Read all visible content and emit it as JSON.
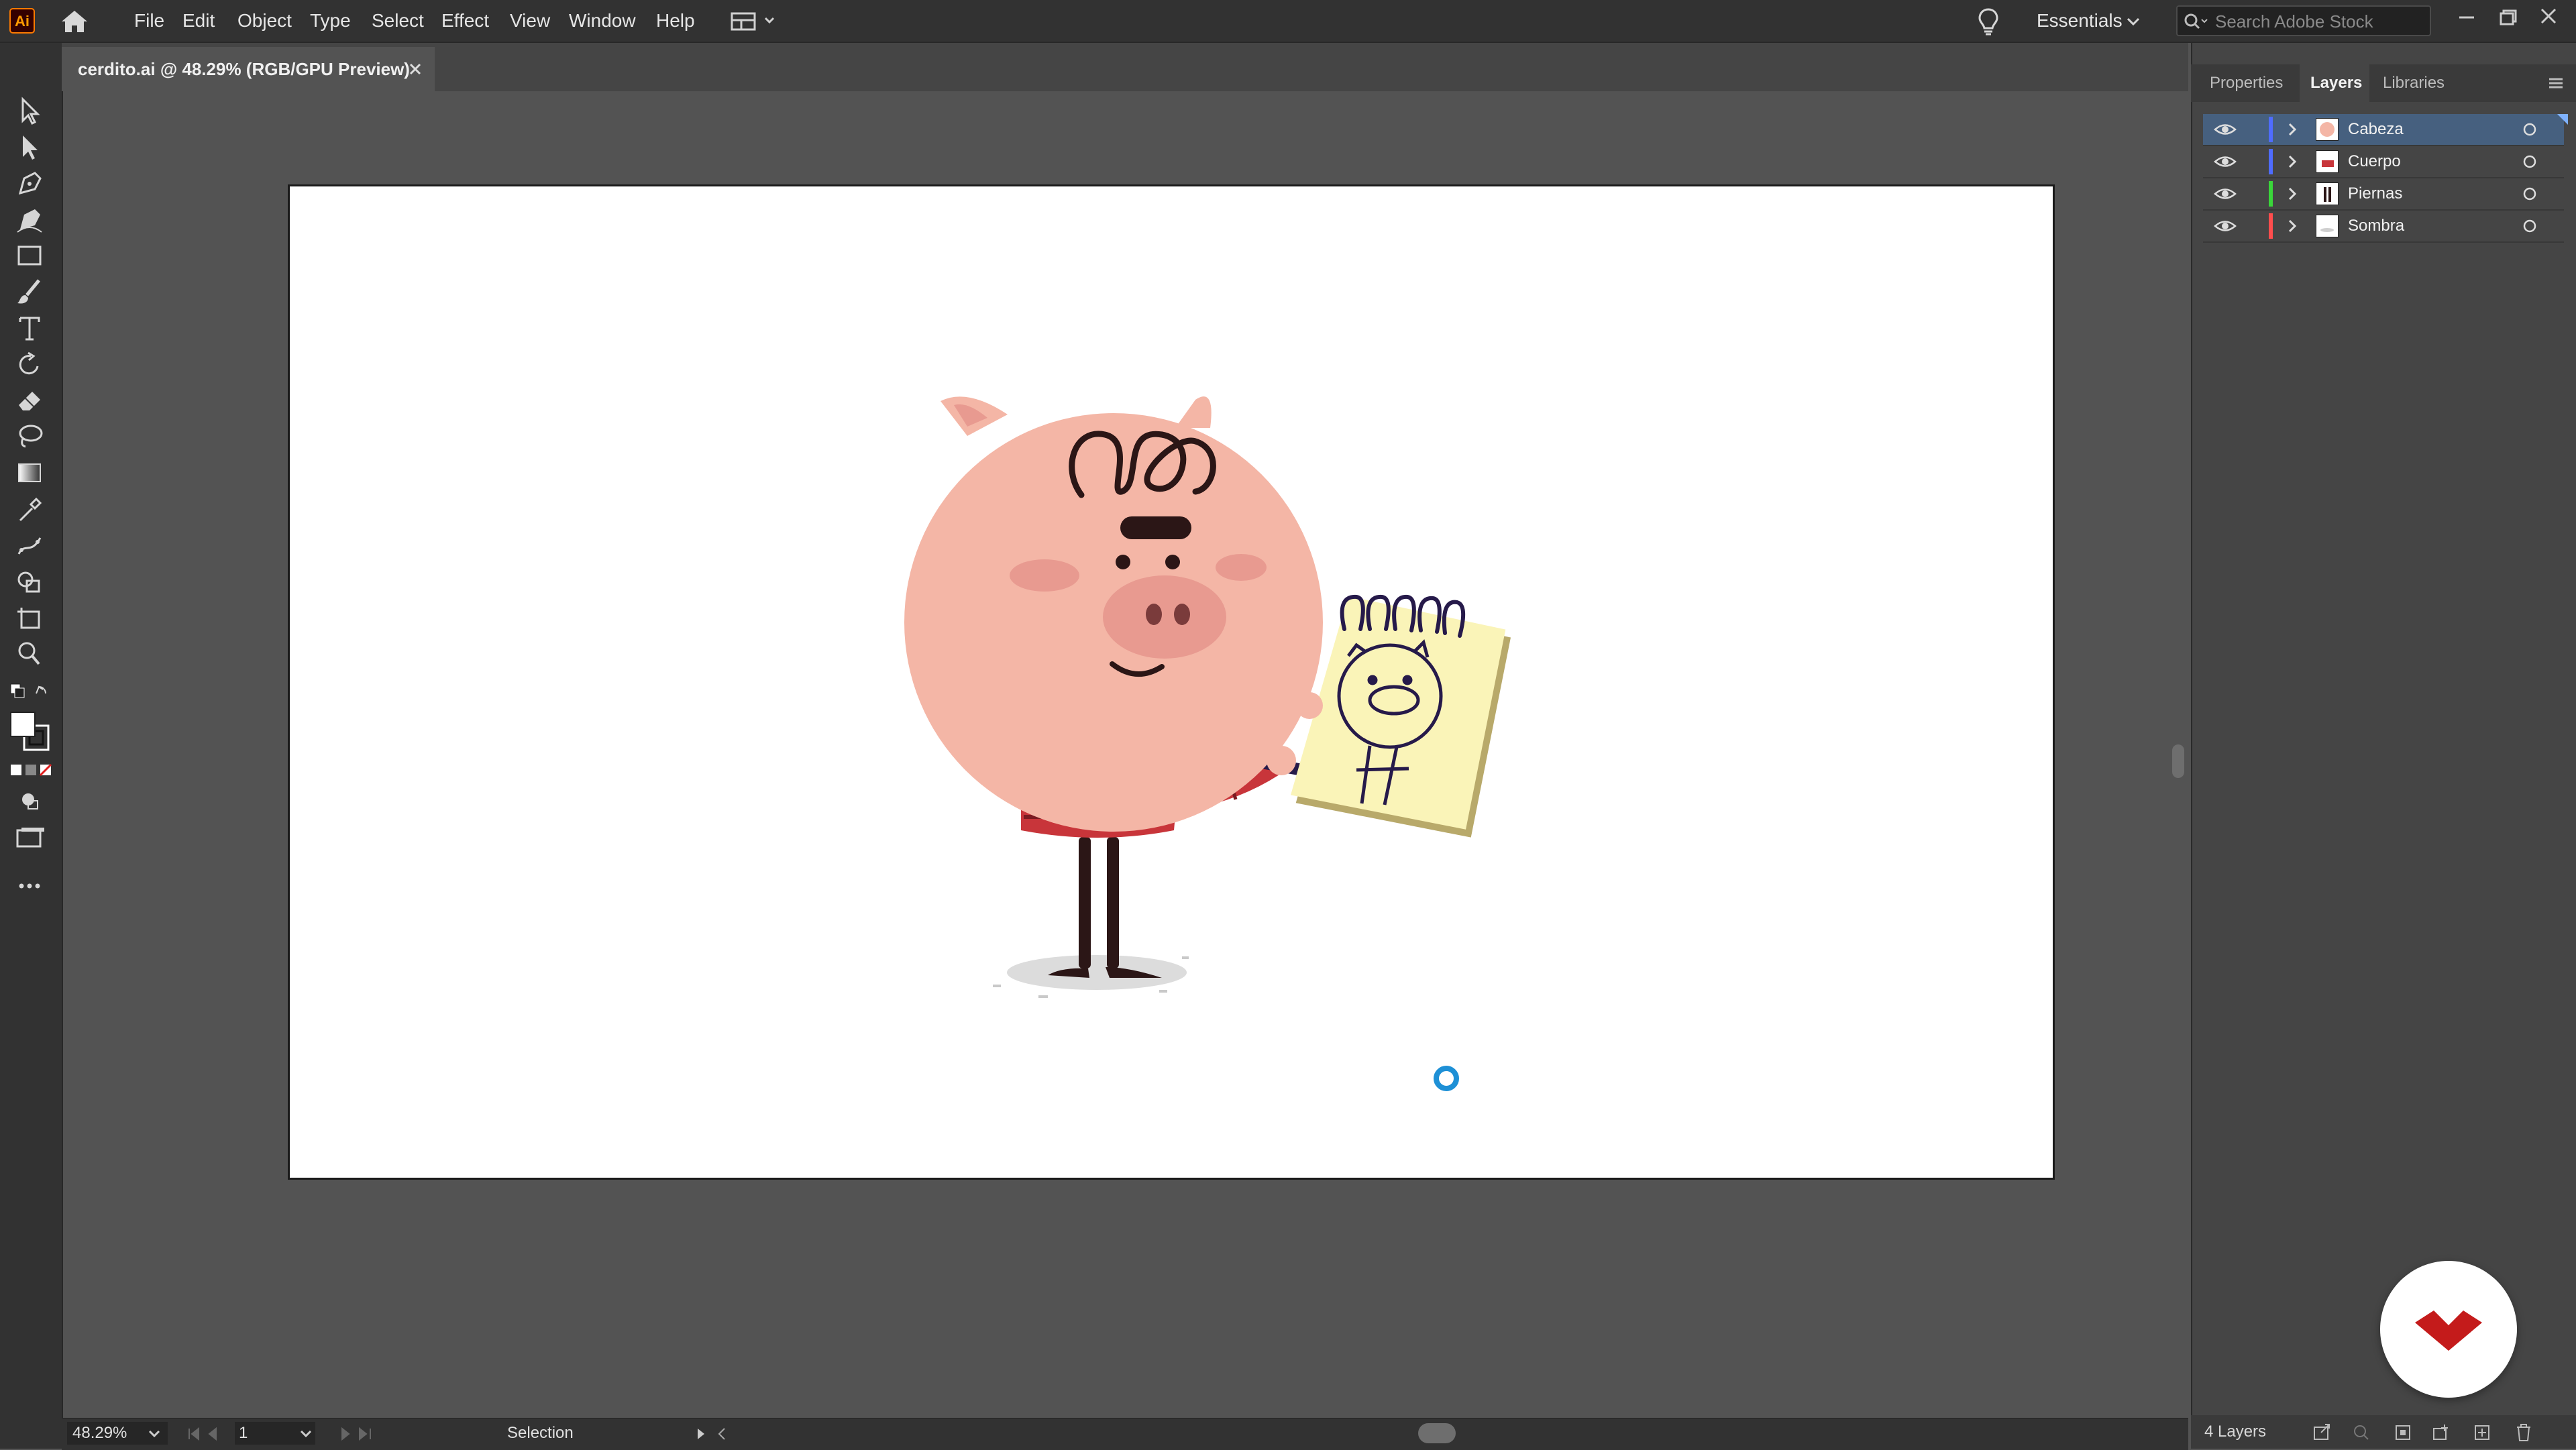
{
  "app": {
    "logo_text": "Ai"
  },
  "menu": {
    "items": [
      "File",
      "Edit",
      "Object",
      "Type",
      "Select",
      "Effect",
      "View",
      "Window",
      "Help"
    ],
    "workspace": "Essentials",
    "search_placeholder": "Search Adobe Stock"
  },
  "document": {
    "tab_label": "cerdito.ai @ 48.29% (RGB/GPU Preview)"
  },
  "status": {
    "zoom": "48.29%",
    "artboard_number": "1",
    "tool_name": "Selection"
  },
  "panel": {
    "tabs": [
      "Properties",
      "Layers",
      "Libraries"
    ],
    "active_tab": "Layers",
    "layers": [
      {
        "name": "Cabeza",
        "color": "#4f6cff",
        "selected": true
      },
      {
        "name": "Cuerpo",
        "color": "#4f6cff",
        "selected": false
      },
      {
        "name": "Piernas",
        "color": "#3ad63a",
        "selected": false
      },
      {
        "name": "Sombra",
        "color": "#ff4d4d",
        "selected": false
      }
    ],
    "layer_count": "4 Layers"
  },
  "icons": [
    "home-icon",
    "lightbulb-icon",
    "search-icon",
    "minimize-icon",
    "maximize-icon",
    "close-icon",
    "selection-tool-icon",
    "direct-selection-tool-icon",
    "pen-tool-icon",
    "curvature-tool-icon",
    "rectangle-tool-icon",
    "paintbrush-tool-icon",
    "type-tool-icon",
    "rotate-tool-icon",
    "eraser-tool-icon",
    "lasso-tool-icon",
    "gradient-tool-icon",
    "eyedropper-tool-icon",
    "puppet-warp-tool-icon",
    "shape-builder-tool-icon",
    "artboard-tool-icon",
    "zoom-tool-icon",
    "eye-icon",
    "chevron-right-icon"
  ],
  "colors": {
    "accent": "#46607f",
    "cursor": "#1e90d6",
    "pig_pink": "#f4b6a6",
    "stripe_red": "#c8353a"
  }
}
